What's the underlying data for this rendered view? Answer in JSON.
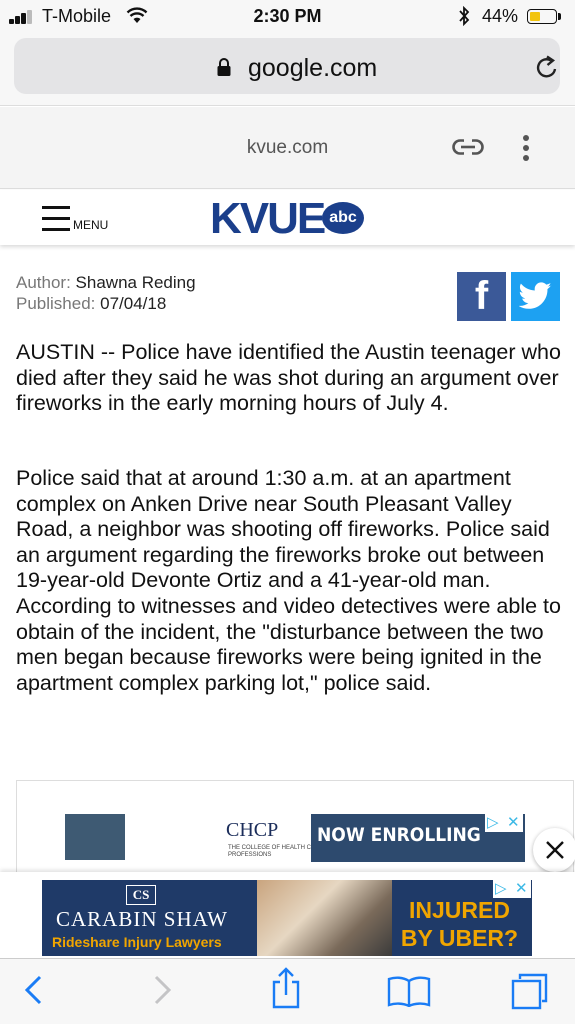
{
  "status_bar": {
    "carrier": "T-Mobile",
    "time": "2:30 PM",
    "battery_percent": "44%",
    "battery_level": 0.44,
    "battery_color": "#f2c40e",
    "icons": [
      "signal-icon",
      "wifi-icon",
      "bluetooth-icon",
      "battery-icon"
    ]
  },
  "browser": {
    "url": "google.com",
    "icons": [
      "lock-icon",
      "reload-icon"
    ]
  },
  "amp_header": {
    "domain": "kvue.com",
    "icons": [
      "link-icon",
      "more-icon"
    ]
  },
  "site_nav": {
    "menu_label": "MENU",
    "logo_text": "KVUE",
    "logo_badge": "abc",
    "brand_color": "#1b3f8b"
  },
  "article": {
    "author_label": "Author:",
    "author": "Shawna Reding",
    "published_label": "Published:",
    "published": "07/04/18",
    "share": [
      "facebook",
      "twitter"
    ],
    "paragraphs": [
      "AUSTIN -- Police have identified the Austin teenager who died after they said he was shot during an argument over fireworks in the early morning hours of July 4.",
      "Police said that at around 1:30 a.m. at an apartment complex on Anken Drive near South Pleasant Valley Road, a neighbor was shooting off fireworks. Police said an argument regarding the fireworks broke out between 19-year-old Devonte Ortiz and a 41-year-old man. According to witnesses and video detectives were able to obtain of the incident, the \"disturbance between the two men began because fireworks were being ignited in the apartment complex parking lot,\" police said."
    ]
  },
  "ad_inline": {
    "logo_text": "CHCP",
    "logo_sub": "THE COLLEGE OF HEALTH CARE PROFESSIONS",
    "headline": "NOW ENROLLING"
  },
  "ad_sticky": {
    "logo_text": "CS",
    "name": "CARABIN SHAW",
    "sub": "Rideshare Injury Lawyers",
    "headline_1": "INJURED",
    "headline_2": "BY UBER?"
  },
  "toolbar": {
    "buttons": [
      "back",
      "forward",
      "share",
      "bookmarks",
      "tabs"
    ]
  }
}
